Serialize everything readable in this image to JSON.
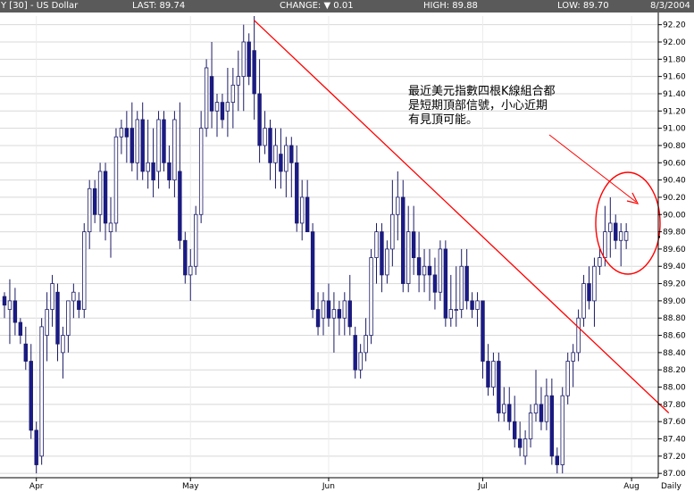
{
  "header": {
    "symbol": "Y [30] - US Dollar",
    "last": "LAST: 89.74",
    "change": "CHANGE: ▼ 0.01",
    "high": "HIGH: 89.88",
    "low": "LOW: 89.70",
    "date": "8/3/2004"
  },
  "chart_data": {
    "type": "candlestick",
    "title": "Y [30] - US Dollar",
    "ylim": [
      86.95,
      92.3
    ],
    "yticks": [
      "92.20",
      "92.00",
      "91.80",
      "91.60",
      "91.40",
      "91.20",
      "91.00",
      "90.80",
      "90.60",
      "90.40",
      "90.20",
      "90.00",
      "89.80",
      "89.60",
      "89.40",
      "89.20",
      "89.00",
      "88.80",
      "88.60",
      "88.40",
      "88.20",
      "88.00",
      "87.80",
      "87.60",
      "87.40",
      "87.20",
      "87.00"
    ],
    "ytick_values": [
      92.2,
      92.0,
      91.8,
      91.6,
      91.4,
      91.2,
      91.0,
      90.8,
      90.6,
      90.4,
      90.2,
      90.0,
      89.8,
      89.6,
      89.4,
      89.2,
      89.0,
      88.8,
      88.6,
      88.4,
      88.2,
      88.0,
      87.8,
      87.6,
      87.4,
      87.2,
      87.0
    ],
    "xticks": [
      "Apr",
      "May",
      "Jun",
      "Jul",
      "Aug"
    ],
    "period_label": "Daily",
    "last_value": 89.74,
    "annotation": [
      "最近美元指數四根K線組合都",
      "是短期頂部信號，小心近期",
      "有見頂可能。"
    ],
    "trendline": {
      "start": {
        "index": 47,
        "value": 92.25
      },
      "end": {
        "index": 125,
        "value": 87.7
      }
    },
    "candles": [
      [
        89.05,
        89.1,
        88.8,
        88.95
      ],
      [
        88.9,
        89.25,
        88.5,
        89.0
      ],
      [
        89.0,
        89.15,
        88.6,
        88.75
      ],
      [
        88.75,
        88.8,
        88.5,
        88.6
      ],
      [
        88.5,
        88.7,
        88.2,
        88.3
      ],
      [
        88.3,
        88.5,
        87.4,
        87.5
      ],
      [
        87.5,
        87.6,
        87.0,
        87.1
      ],
      [
        87.2,
        88.8,
        87.1,
        88.7
      ],
      [
        88.6,
        89.1,
        88.3,
        88.9
      ],
      [
        88.9,
        89.3,
        88.7,
        89.2
      ],
      [
        89.1,
        89.2,
        88.3,
        88.5
      ],
      [
        88.4,
        88.7,
        88.1,
        88.6
      ],
      [
        88.6,
        89.0,
        88.4,
        89.0
      ],
      [
        89.0,
        89.2,
        88.8,
        89.1
      ],
      [
        89.0,
        89.1,
        88.8,
        88.9
      ],
      [
        88.9,
        89.9,
        88.8,
        89.8
      ],
      [
        89.8,
        90.4,
        89.6,
        90.3
      ],
      [
        90.3,
        90.4,
        89.9,
        90.0
      ],
      [
        90.0,
        90.6,
        89.8,
        90.5
      ],
      [
        90.5,
        90.6,
        89.7,
        89.9
      ],
      [
        89.8,
        90.2,
        89.5,
        89.9
      ],
      [
        89.9,
        91.0,
        89.8,
        90.9
      ],
      [
        90.9,
        91.1,
        90.7,
        91.0
      ],
      [
        91.0,
        91.2,
        90.6,
        90.9
      ],
      [
        91.0,
        91.3,
        90.5,
        90.6
      ],
      [
        90.6,
        91.2,
        90.4,
        91.1
      ],
      [
        91.1,
        91.3,
        90.4,
        90.5
      ],
      [
        90.5,
        91.1,
        90.3,
        90.6
      ],
      [
        90.6,
        91.0,
        90.2,
        90.4
      ],
      [
        90.5,
        91.2,
        90.3,
        91.1
      ],
      [
        91.1,
        91.2,
        90.5,
        90.6
      ],
      [
        90.6,
        90.8,
        90.3,
        90.4
      ],
      [
        90.4,
        91.2,
        90.2,
        91.1
      ],
      [
        90.5,
        91.3,
        89.6,
        89.7
      ],
      [
        89.7,
        89.8,
        89.2,
        89.3
      ],
      [
        89.3,
        89.6,
        89.0,
        89.4
      ],
      [
        89.4,
        90.1,
        89.3,
        90.0
      ],
      [
        90.0,
        91.2,
        89.9,
        91.0
      ],
      [
        91.0,
        91.8,
        90.9,
        91.7
      ],
      [
        91.6,
        92.0,
        91.0,
        91.2
      ],
      [
        91.2,
        91.4,
        90.9,
        91.3
      ],
      [
        91.3,
        91.4,
        91.0,
        91.1
      ],
      [
        91.2,
        91.7,
        90.9,
        91.3
      ],
      [
        91.3,
        91.7,
        91.0,
        91.5
      ],
      [
        91.5,
        91.9,
        91.2,
        91.6
      ],
      [
        91.6,
        92.2,
        91.2,
        92.0
      ],
      [
        92.0,
        92.1,
        91.5,
        91.6
      ],
      [
        91.9,
        92.3,
        91.1,
        91.4
      ],
      [
        91.4,
        91.8,
        90.6,
        90.8
      ],
      [
        90.8,
        91.2,
        90.7,
        91.0
      ],
      [
        91.0,
        91.1,
        90.4,
        90.6
      ],
      [
        90.6,
        91.0,
        90.3,
        90.8
      ],
      [
        90.7,
        91.0,
        90.3,
        90.5
      ],
      [
        90.5,
        90.9,
        90.2,
        90.8
      ],
      [
        90.8,
        90.9,
        90.2,
        90.6
      ],
      [
        90.6,
        90.8,
        89.8,
        89.9
      ],
      [
        89.9,
        90.4,
        89.7,
        90.2
      ],
      [
        90.2,
        90.4,
        89.8,
        89.8
      ],
      [
        89.8,
        89.9,
        88.8,
        88.9
      ],
      [
        88.9,
        89.1,
        88.6,
        88.7
      ],
      [
        88.8,
        89.1,
        88.6,
        89.0
      ],
      [
        89.0,
        89.2,
        88.7,
        88.8
      ],
      [
        88.8,
        89.1,
        88.4,
        88.9
      ],
      [
        88.9,
        89.0,
        88.6,
        88.8
      ],
      [
        88.8,
        89.1,
        88.6,
        89.0
      ],
      [
        89.0,
        89.3,
        88.6,
        88.7
      ],
      [
        88.6,
        88.7,
        88.1,
        88.2
      ],
      [
        88.2,
        88.5,
        88.1,
        88.4
      ],
      [
        88.4,
        88.8,
        88.3,
        88.6
      ],
      [
        88.6,
        89.6,
        88.5,
        89.5
      ],
      [
        89.5,
        89.9,
        89.2,
        89.8
      ],
      [
        89.8,
        89.9,
        89.1,
        89.3
      ],
      [
        89.3,
        89.7,
        89.2,
        89.6
      ],
      [
        89.6,
        90.4,
        89.4,
        90.0
      ],
      [
        90.0,
        90.5,
        89.7,
        90.2
      ],
      [
        90.2,
        90.4,
        89.1,
        89.2
      ],
      [
        89.2,
        90.1,
        89.1,
        89.8
      ],
      [
        89.8,
        90.1,
        89.3,
        89.5
      ],
      [
        89.5,
        89.8,
        89.1,
        89.3
      ],
      [
        89.3,
        89.6,
        89.1,
        89.4
      ],
      [
        89.4,
        89.6,
        89.0,
        89.3
      ],
      [
        89.3,
        89.5,
        88.9,
        89.1
      ],
      [
        89.1,
        89.7,
        89.0,
        89.6
      ],
      [
        89.6,
        89.7,
        88.7,
        88.8
      ],
      [
        88.8,
        89.3,
        88.7,
        88.9
      ],
      [
        88.9,
        89.4,
        88.7,
        88.9
      ],
      [
        88.9,
        89.6,
        88.8,
        89.4
      ],
      [
        89.4,
        89.6,
        88.9,
        89.0
      ],
      [
        89.0,
        89.1,
        88.8,
        88.9
      ],
      [
        88.9,
        89.1,
        88.7,
        89.0
      ],
      [
        89.0,
        89.0,
        88.1,
        88.3
      ],
      [
        88.3,
        88.5,
        87.9,
        88.0
      ],
      [
        88.0,
        88.4,
        87.9,
        88.3
      ],
      [
        88.3,
        88.4,
        87.6,
        87.7
      ],
      [
        87.7,
        88.0,
        87.6,
        87.8
      ],
      [
        87.8,
        88.0,
        87.5,
        87.6
      ],
      [
        87.6,
        87.9,
        87.3,
        87.4
      ],
      [
        87.4,
        87.6,
        87.2,
        87.3
      ],
      [
        87.2,
        87.5,
        87.1,
        87.4
      ],
      [
        87.4,
        87.8,
        87.3,
        87.7
      ],
      [
        87.7,
        88.2,
        87.6,
        87.8
      ],
      [
        87.8,
        88.0,
        87.5,
        87.6
      ],
      [
        87.6,
        88.1,
        87.5,
        87.9
      ],
      [
        87.9,
        88.1,
        87.1,
        87.2
      ],
      [
        87.2,
        87.3,
        87.0,
        87.1
      ],
      [
        87.1,
        88.0,
        87.0,
        87.9
      ],
      [
        87.9,
        88.4,
        87.8,
        88.3
      ],
      [
        88.3,
        88.5,
        88.0,
        88.4
      ],
      [
        88.4,
        88.9,
        88.3,
        88.8
      ],
      [
        88.8,
        89.3,
        88.7,
        89.2
      ],
      [
        89.2,
        89.4,
        88.9,
        89.0
      ],
      [
        89.0,
        89.5,
        88.7,
        89.4
      ],
      [
        89.4,
        89.6,
        89.3,
        89.5
      ],
      [
        89.5,
        90.1,
        89.4,
        89.8
      ],
      [
        89.8,
        90.2,
        89.5,
        89.9
      ],
      [
        89.9,
        90.0,
        89.6,
        89.7
      ],
      [
        89.7,
        89.9,
        89.4,
        89.8
      ],
      [
        89.7,
        89.9,
        89.6,
        89.8
      ]
    ]
  }
}
